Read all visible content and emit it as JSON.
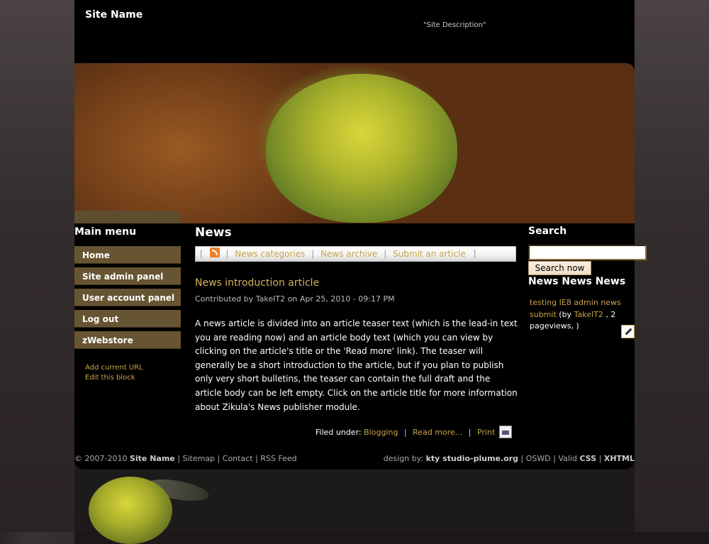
{
  "header": {
    "site_name": "Site Name",
    "site_description": "\"Site Description\""
  },
  "main_menu": {
    "title": "Main menu",
    "items": [
      {
        "label": "Home"
      },
      {
        "label": "Site admin panel"
      },
      {
        "label": "User account panel"
      },
      {
        "label": "Log out"
      },
      {
        "label": "zWebstore"
      }
    ],
    "add_url": "Add current URL",
    "edit_block": "Edit this block"
  },
  "news": {
    "title": "News",
    "nav": {
      "open_bracket": "[",
      "categories": "News categories",
      "archive": "News archive",
      "submit": "Submit an article",
      "close_bracket": "]",
      "sep": "|"
    },
    "article": {
      "title": "News introduction article",
      "meta": "Contributed by TakeIT2 on Apr 25, 2010 - 09:17 PM",
      "body": "A news article is divided into an article teaser text (which is the lead-in text you are reading now) and an article body text (which you can view by clicking on the article's title or the 'Read more' link). The teaser will generally be a short introduction to the article, but if you plan to publish only very short bulletins, the teaser can contain the full draft and the article body can be left empty. Click on the article title for more information about Zikula's News publisher module.",
      "filed_label": "Filed under:",
      "category": "Blogging",
      "read_more": "Read more...",
      "print": "Print"
    }
  },
  "search": {
    "title": "Search",
    "placeholder": "",
    "button": "Search now"
  },
  "nnn": {
    "title": "News News News",
    "entry_link": "testing IE8 admin news submit",
    "entry_by": "(by",
    "entry_author": "TakeIT2",
    "entry_rest": ", 2 pageviews, )"
  },
  "footer": {
    "copyright": "© 2007-2010",
    "site_name": "Site Name",
    "sitemap": "Sitemap",
    "contact": "Contact",
    "rss": "RSS Feed",
    "design_by": "design by:",
    "designer": "kty studio-plume.org",
    "oswd": "OSWD",
    "valid": "Valid",
    "css": "CSS",
    "xhtml": "XHTML",
    "sep": "|"
  },
  "colors": {
    "accent": "#c9a24a",
    "menu_bg": "#675432",
    "page_bg": "#000000"
  },
  "icons": [
    "rss-icon",
    "print-icon",
    "edit-icon"
  ]
}
